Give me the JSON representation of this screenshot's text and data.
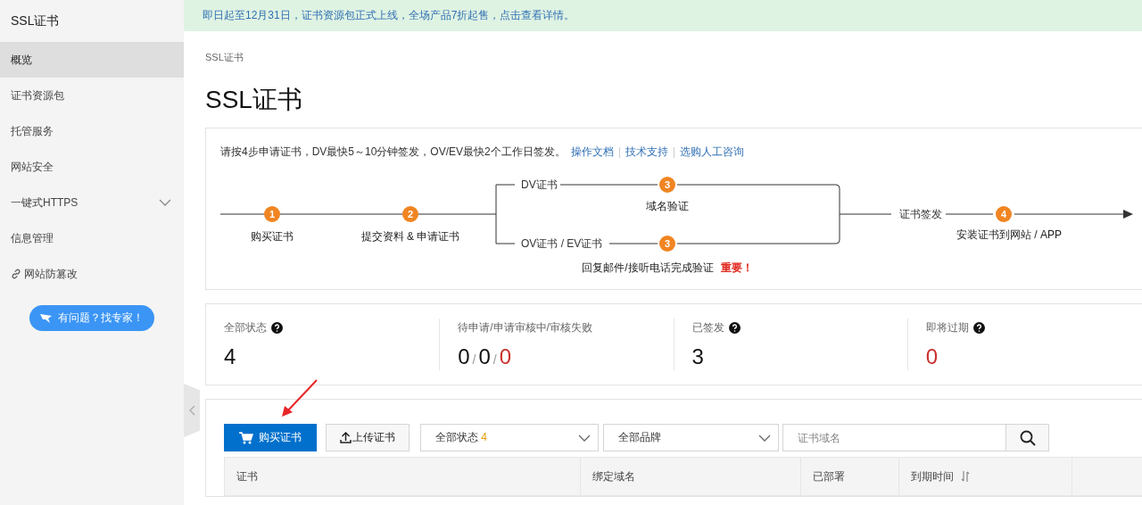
{
  "banner": {
    "text": "即日起至12月31日，证书资源包正式上线，全场产品7折起售，点击查看详情。"
  },
  "sidebar": {
    "title": "SSL证书",
    "items": [
      {
        "label": "概览",
        "kind": "plain",
        "selected": true
      },
      {
        "label": "证书资源包",
        "kind": "plain",
        "selected": false
      },
      {
        "label": "托管服务",
        "kind": "plain",
        "selected": false
      },
      {
        "label": "网站安全",
        "kind": "plain",
        "selected": false
      },
      {
        "label": "一键式HTTPS",
        "kind": "expandable",
        "selected": false,
        "expanded": false
      },
      {
        "label": "信息管理",
        "kind": "plain",
        "selected": false
      },
      {
        "label": "网站防篡改",
        "kind": "link",
        "selected": false
      }
    ],
    "help_button": "有问题？找专家！"
  },
  "breadcrumb": "SSL证书",
  "title": "SSL证书",
  "flow": {
    "intro": "请按4步申请证书，DV最快5～10分钟签发，OV/EV最快2个工作日签发。",
    "links": [
      "操作文档",
      "技术支持",
      "选购人工咨询"
    ],
    "steps": [
      {
        "number": "1",
        "label": "购买证书"
      },
      {
        "number": "2",
        "label": "提交资料 & 申请证书"
      }
    ],
    "branches": [
      {
        "name": "DV证书",
        "number": "3",
        "label": "域名验证"
      },
      {
        "name": "OV证书 / EV证书",
        "number": "3",
        "label": "回复邮件/接听电话完成验证",
        "warning": "重要！"
      }
    ],
    "issue_label": "证书签发",
    "final_step": {
      "number": "4",
      "label": "安装证书到网站 / APP"
    }
  },
  "stats": [
    {
      "label": "全部状态",
      "help": true,
      "values": [
        {
          "text": "4",
          "alert": false
        }
      ]
    },
    {
      "label": "待申请/申请审核中/审核失败",
      "help": false,
      "separator": "/",
      "values": [
        {
          "text": "0",
          "alert": false
        },
        {
          "text": "0",
          "alert": false
        },
        {
          "text": "0",
          "alert": true
        }
      ]
    },
    {
      "label": "已签发",
      "help": true,
      "values": [
        {
          "text": "3",
          "alert": false
        }
      ]
    },
    {
      "label": "即将过期",
      "help": true,
      "values": [
        {
          "text": "0",
          "alert": true
        }
      ]
    }
  ],
  "toolbar": {
    "buy_button": "购买证书",
    "upload_button": "上传证书",
    "status_filter": {
      "label": "全部状态",
      "count": "4"
    },
    "brand_filter": {
      "label": "全部品牌"
    },
    "search": {
      "placeholder": "证书域名"
    }
  },
  "table": {
    "columns": [
      {
        "label": "证书",
        "sortable": false
      },
      {
        "label": "绑定域名",
        "sortable": false
      },
      {
        "label": "已部署",
        "sortable": false
      },
      {
        "label": "到期时间",
        "sortable": true
      }
    ]
  }
}
